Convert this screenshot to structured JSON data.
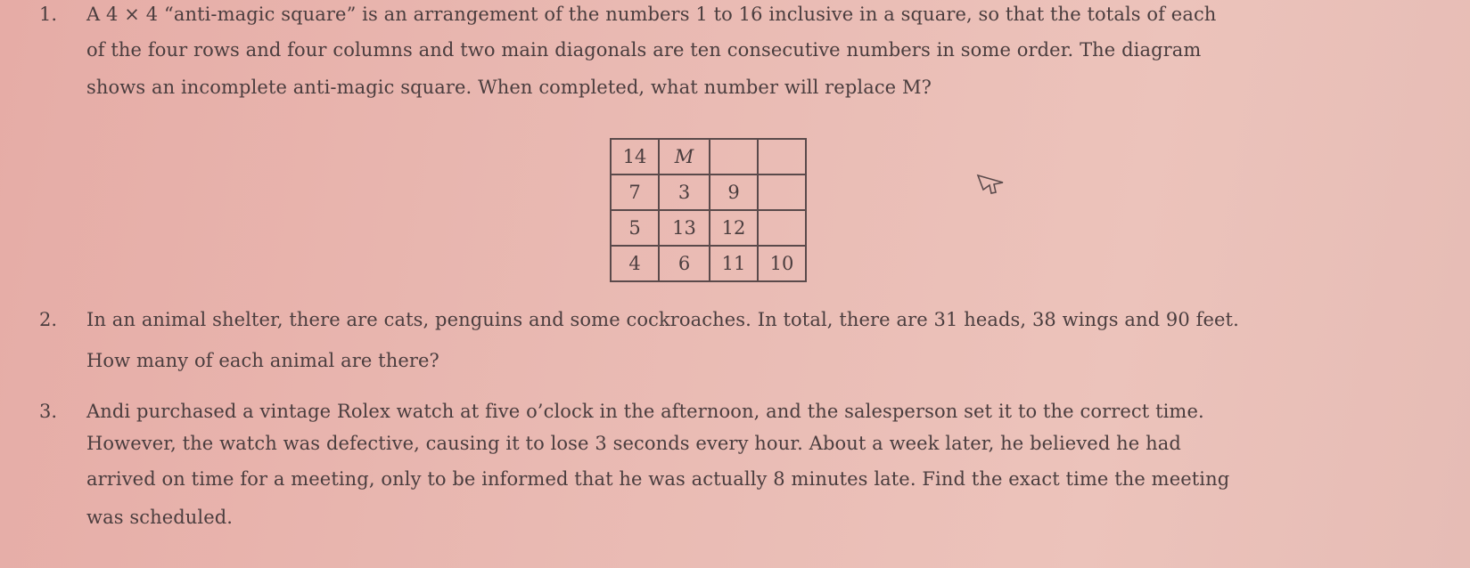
{
  "problems": [
    {
      "number": "1.",
      "lines": [
        "A 4 × 4 “anti-magic square” is an arrangement of the numbers 1 to 16 inclusive in a square, so that the totals of each",
        "of the four rows and four columns and two main diagonals are ten consecutive numbers in some order.  The diagram",
        "shows an incomplete anti-magic square.  When completed, what number will replace M?"
      ]
    },
    {
      "number": "2.",
      "lines": [
        "In an animal shelter, there are cats, penguins and some cockroaches.  In total, there are 31 heads, 38 wings and 90 feet.",
        "How many of each animal are there?"
      ]
    },
    {
      "number": "3.",
      "lines": [
        "Andi purchased a vintage Rolex watch at five o’clock in the afternoon, and the salesperson set it to the correct time.",
        "However, the watch was defective, causing it to lose 3 seconds every hour.  About a week later, he believed he had",
        "arrived on time for a meeting, only to be informed that he was actually 8 minutes late.  Find the exact time the meeting",
        "was scheduled."
      ]
    }
  ],
  "grid": [
    [
      "14",
      "M",
      "",
      ""
    ],
    [
      "7",
      "3",
      "9",
      ""
    ],
    [
      "5",
      "13",
      "12",
      ""
    ],
    [
      "4",
      "6",
      "11",
      "10"
    ]
  ],
  "cursor_icon": "mouse-pointer-icon"
}
